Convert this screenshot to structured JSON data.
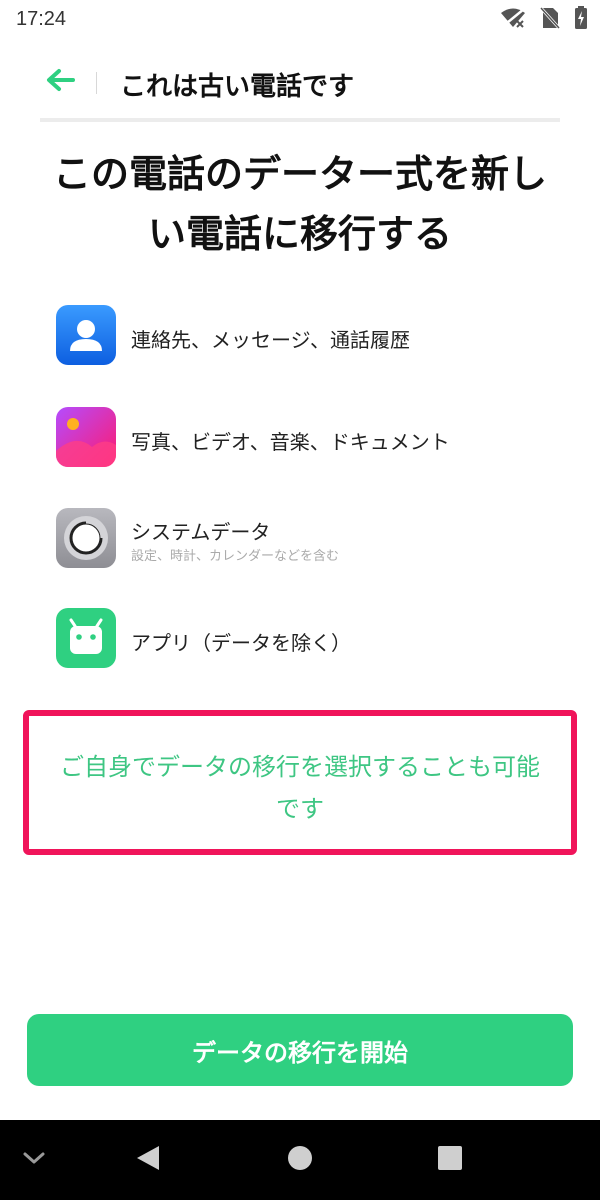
{
  "status_bar": {
    "time": "17:24",
    "icons": [
      "wifi-off-icon",
      "no-sim-icon",
      "battery-charging-icon"
    ]
  },
  "header": {
    "back_icon": "arrow-left-icon",
    "title": "これは古い電話です"
  },
  "main": {
    "heading_line1": "この電話のデーター式を新し",
    "heading_line2": "い電話に移行する",
    "items": [
      {
        "icon": "contacts-icon",
        "label": "連絡先、メッセージ、通話履歴",
        "color": "#1a73f0"
      },
      {
        "icon": "photos-icon",
        "label": "写真、ビデオ、音楽、ドキュメント",
        "color": "#e91e8c"
      },
      {
        "icon": "system-settings-icon",
        "label": "システムデータ",
        "sublabel": "設定、時計、カレンダーなどを含む",
        "color": "#9e9ea4"
      },
      {
        "icon": "android-apps-icon",
        "label": "アプリ（データを除く）",
        "color": "#2fd081"
      }
    ],
    "select_link": "ご自身でデータの移行を選択することも可能です"
  },
  "actions": {
    "start_label": "データの移行を開始"
  },
  "nav_bar": {
    "icons": [
      "chevron-down-icon",
      "back-triangle-icon",
      "home-circle-icon",
      "recents-square-icon"
    ]
  },
  "colors": {
    "accent": "#2fd081",
    "link": "#3ec683",
    "highlight": "#f0145a"
  }
}
